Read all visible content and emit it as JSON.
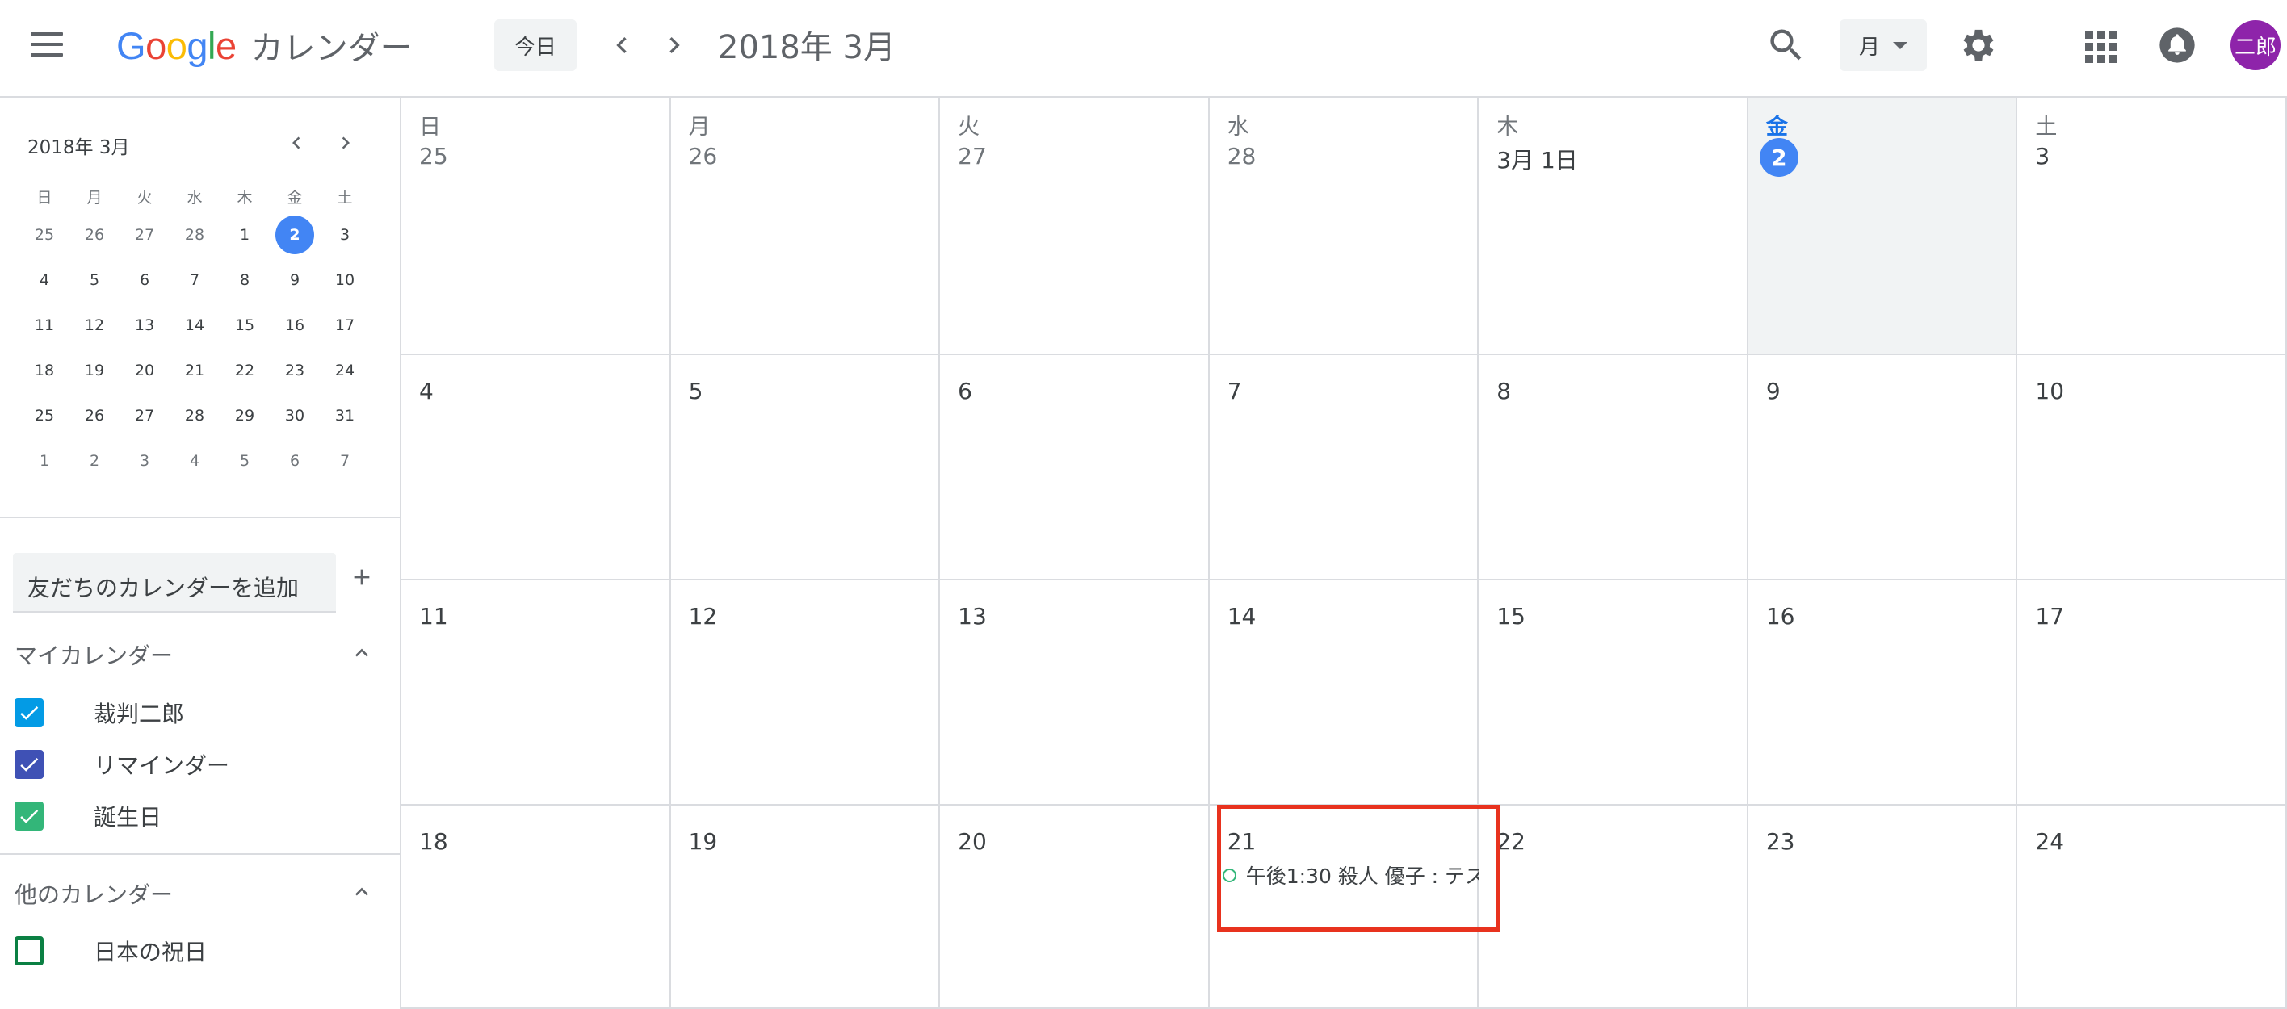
{
  "header": {
    "logo_letters": [
      {
        "ch": "G",
        "color": "#4285F4"
      },
      {
        "ch": "o",
        "color": "#EA4335"
      },
      {
        "ch": "o",
        "color": "#FBBC05"
      },
      {
        "ch": "g",
        "color": "#4285F4"
      },
      {
        "ch": "l",
        "color": "#34A853"
      },
      {
        "ch": "e",
        "color": "#EA4335"
      }
    ],
    "app_name": "カレンダー",
    "today_button": "今日",
    "period_title": "2018年 3月",
    "view_label": "月",
    "avatar_text": "二郎",
    "icons": [
      "menu-icon",
      "chevron-left-icon",
      "chevron-right-icon",
      "search-icon",
      "dropdown-caret-icon",
      "gear-icon",
      "apps-grid-icon",
      "bell-icon"
    ]
  },
  "sidebar": {
    "mini_title": "2018年 3月",
    "mini_weekdays": [
      "日",
      "月",
      "火",
      "水",
      "木",
      "金",
      "土"
    ],
    "mini_weeks": [
      [
        {
          "d": "25",
          "o": true
        },
        {
          "d": "26",
          "o": true
        },
        {
          "d": "27",
          "o": true
        },
        {
          "d": "28",
          "o": true
        },
        {
          "d": "1"
        },
        {
          "d": "2",
          "today": true
        },
        {
          "d": "3"
        }
      ],
      [
        {
          "d": "4"
        },
        {
          "d": "5"
        },
        {
          "d": "6"
        },
        {
          "d": "7"
        },
        {
          "d": "8"
        },
        {
          "d": "9"
        },
        {
          "d": "10"
        }
      ],
      [
        {
          "d": "11"
        },
        {
          "d": "12"
        },
        {
          "d": "13"
        },
        {
          "d": "14"
        },
        {
          "d": "15"
        },
        {
          "d": "16"
        },
        {
          "d": "17"
        }
      ],
      [
        {
          "d": "18"
        },
        {
          "d": "19"
        },
        {
          "d": "20"
        },
        {
          "d": "21"
        },
        {
          "d": "22"
        },
        {
          "d": "23"
        },
        {
          "d": "24"
        }
      ],
      [
        {
          "d": "25"
        },
        {
          "d": "26"
        },
        {
          "d": "27"
        },
        {
          "d": "28"
        },
        {
          "d": "29"
        },
        {
          "d": "30"
        },
        {
          "d": "31"
        }
      ],
      [
        {
          "d": "1",
          "o": true
        },
        {
          "d": "2",
          "o": true
        },
        {
          "d": "3",
          "o": true
        },
        {
          "d": "4",
          "o": true
        },
        {
          "d": "5",
          "o": true
        },
        {
          "d": "6",
          "o": true
        },
        {
          "d": "7",
          "o": true
        }
      ]
    ],
    "add_friend_placeholder": "友だちのカレンダーを追加",
    "my_calendars_title": "マイカレンダー",
    "my_calendars": [
      {
        "label": "裁判二郎",
        "color": "#039be5",
        "checked": true
      },
      {
        "label": "リマインダー",
        "color": "#3f51b5",
        "checked": true
      },
      {
        "label": "誕生日",
        "color": "#33b679",
        "checked": true
      }
    ],
    "other_calendars_title": "他のカレンダー",
    "other_calendars": [
      {
        "label": "日本の祝日",
        "color": "#0b8043",
        "checked": false
      }
    ]
  },
  "month": {
    "weekdays": [
      "日",
      "月",
      "火",
      "水",
      "木",
      "金",
      "土"
    ],
    "weeks": [
      [
        {
          "d": "25",
          "o": true
        },
        {
          "d": "26",
          "o": true
        },
        {
          "d": "27",
          "o": true
        },
        {
          "d": "28",
          "o": true
        },
        {
          "d": "3月 1日"
        },
        {
          "d": "2",
          "today": true
        },
        {
          "d": "3"
        }
      ],
      [
        {
          "d": "4"
        },
        {
          "d": "5"
        },
        {
          "d": "6"
        },
        {
          "d": "7"
        },
        {
          "d": "8"
        },
        {
          "d": "9"
        },
        {
          "d": "10"
        }
      ],
      [
        {
          "d": "11"
        },
        {
          "d": "12"
        },
        {
          "d": "13"
        },
        {
          "d": "14"
        },
        {
          "d": "15"
        },
        {
          "d": "16"
        },
        {
          "d": "17"
        }
      ],
      [
        {
          "d": "18"
        },
        {
          "d": "19"
        },
        {
          "d": "20"
        },
        {
          "d": "21",
          "event": "午後1:30 殺人 優子 : テス"
        },
        {
          "d": "22"
        },
        {
          "d": "23"
        },
        {
          "d": "24"
        }
      ]
    ],
    "event_color": "#33b679",
    "highlight_color": "#e8321e"
  }
}
